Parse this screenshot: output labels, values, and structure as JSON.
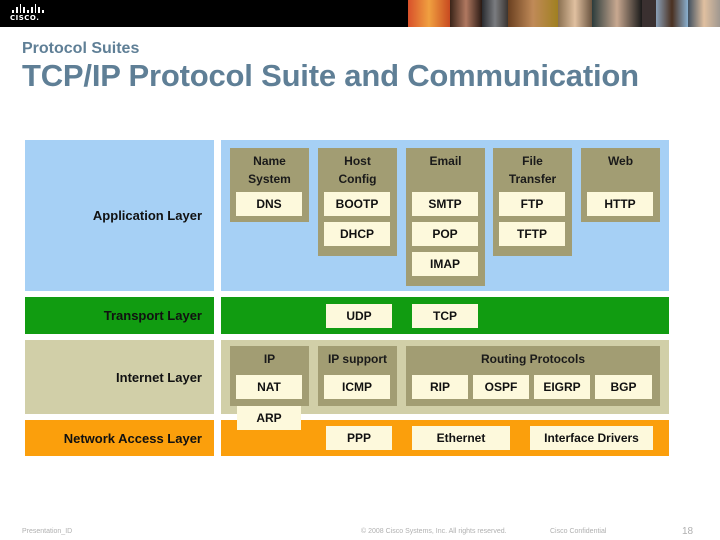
{
  "header": {
    "logo_text": "CISCO.",
    "subtitle": "Protocol Suites",
    "title": "TCP/IP Protocol Suite and Communication"
  },
  "colors": {
    "application": "#a6d0f5",
    "transport": "#119c11",
    "internet": "#d1cfa8",
    "network_access": "#fb9f0c",
    "group": "#a29d73",
    "protocol_box": "#fdf9dc",
    "title": "#5f7f96"
  },
  "layers": {
    "application": {
      "label": "Application Layer",
      "groups": [
        {
          "title1": "Name",
          "title2": "System",
          "protocols": [
            "DNS"
          ]
        },
        {
          "title1": "Host",
          "title2": "Config",
          "protocols": [
            "BOOTP",
            "DHCP"
          ]
        },
        {
          "title1": "Email",
          "title2": "",
          "protocols": [
            "SMTP",
            "POP",
            "IMAP"
          ]
        },
        {
          "title1": "File",
          "title2": "Transfer",
          "protocols": [
            "FTP",
            "TFTP"
          ]
        },
        {
          "title1": "Web",
          "title2": "",
          "protocols": [
            "HTTP"
          ]
        }
      ]
    },
    "transport": {
      "label": "Transport Layer",
      "protocols": [
        "UDP",
        "TCP"
      ]
    },
    "internet": {
      "label": "Internet Layer",
      "groups": [
        {
          "title": "IP",
          "protocols": [
            "NAT"
          ]
        },
        {
          "title": "IP support",
          "protocols": [
            "ICMP"
          ]
        },
        {
          "title": "Routing Protocols",
          "protocols": [
            "RIP",
            "OSPF",
            "EIGRP",
            "BGP"
          ]
        }
      ],
      "extra": "ARP"
    },
    "network_access": {
      "label": "Network Access Layer",
      "protocols": [
        "PPP",
        "Ethernet",
        "Interface Drivers"
      ]
    }
  },
  "footer": {
    "left": "Presentation_ID",
    "copyright": "© 2008 Cisco Systems, Inc. All rights reserved.",
    "confidential": "Cisco Confidential",
    "page": "18"
  }
}
